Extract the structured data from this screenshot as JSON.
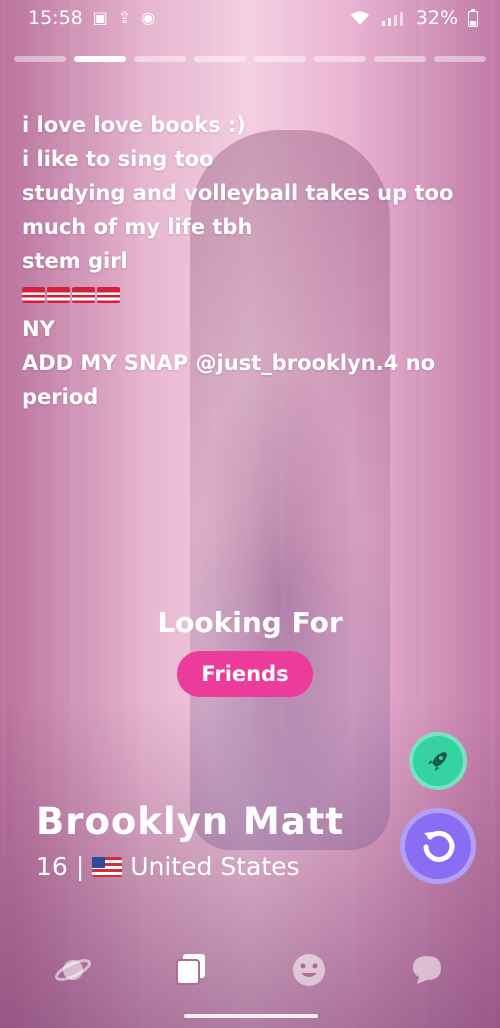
{
  "status_bar": {
    "time": "15:58",
    "battery": "32%"
  },
  "progress": {
    "segments": 8,
    "active_index": 1
  },
  "bio": {
    "lines": [
      "i love love books :)",
      "i like to sing too",
      "studying and volleyball takes up too",
      "much of my life tbh",
      "stem girl",
      "NY",
      "ADD MY SNAP @just_brooklyn.4 no",
      "period"
    ]
  },
  "looking_for": {
    "title": "Looking For",
    "value": "Friends"
  },
  "profile": {
    "name": "Brooklyn Matt",
    "age": "16",
    "separator": "|",
    "country": "United States"
  },
  "colors": {
    "pill": "#ec3b9b",
    "boost": "#35d2a2",
    "rewind": "#8a6df2"
  },
  "nav": {
    "items": [
      "planet-icon",
      "cards-icon",
      "smiley-icon",
      "chat-icon"
    ],
    "active": "cards-icon"
  }
}
